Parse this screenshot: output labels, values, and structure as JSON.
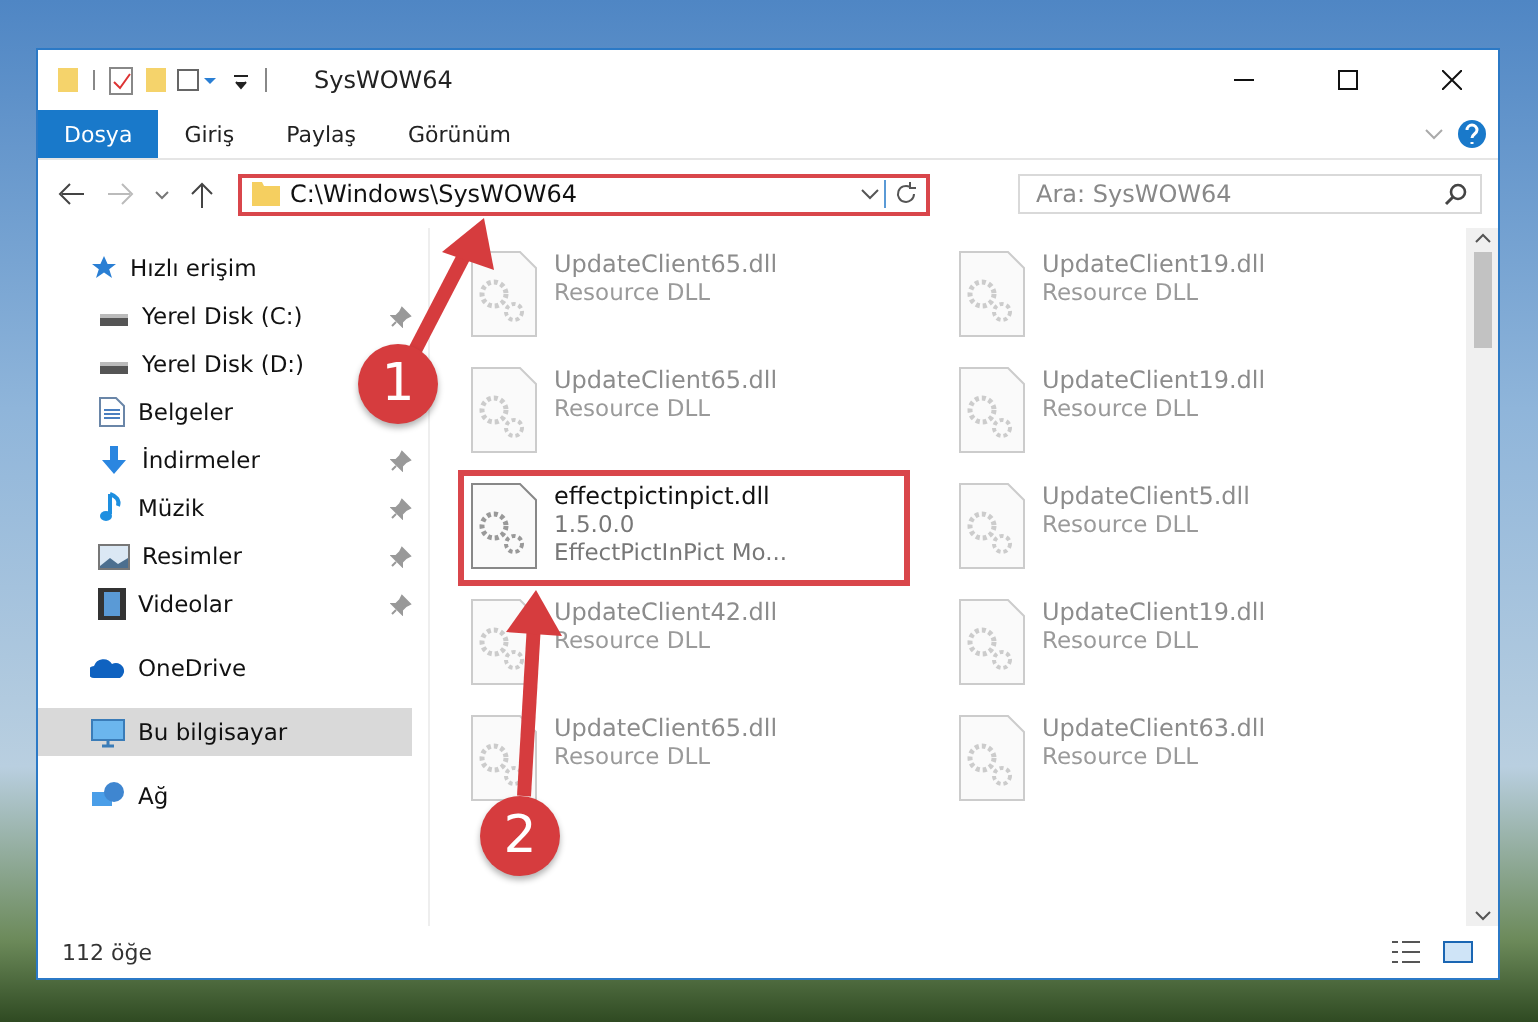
{
  "window": {
    "title": "SysWOW64"
  },
  "ribbon_tabs": [
    {
      "label": "Dosya",
      "selected": true
    },
    {
      "label": "Giriş",
      "selected": false
    },
    {
      "label": "Paylaş",
      "selected": false
    },
    {
      "label": "Görünüm",
      "selected": false
    }
  ],
  "address_bar": {
    "path": "C:\\Windows\\SysWOW64"
  },
  "search": {
    "placeholder": "Ara: SysWOW64"
  },
  "sidebar": {
    "items": [
      {
        "label": "Hızlı erişim",
        "selected": false,
        "children": [
          {
            "label": "Yerel Disk (C:)",
            "pinned": true,
            "selected": false
          },
          {
            "label": "Yerel Disk (D:)",
            "pinned": false,
            "selected": false
          },
          {
            "label": "Belgeler",
            "pinned": false,
            "selected": false
          },
          {
            "label": "İndirmeler",
            "pinned": true,
            "selected": false
          },
          {
            "label": "Müzik",
            "pinned": true,
            "selected": false
          },
          {
            "label": "Resimler",
            "pinned": true,
            "selected": false
          },
          {
            "label": "Videolar",
            "pinned": true,
            "selected": false
          }
        ]
      },
      {
        "label": "OneDrive",
        "selected": false
      },
      {
        "label": "Bu bilgisayar",
        "selected": true
      },
      {
        "label": "Ağ",
        "selected": false
      }
    ]
  },
  "files": [
    {
      "kind": "faded",
      "name": "UpdateClient65.dll",
      "lines": [
        "Resource DLL"
      ]
    },
    {
      "kind": "faded",
      "name": "UpdateClient19.dll",
      "lines": [
        "Resource DLL"
      ]
    },
    {
      "kind": "faded",
      "name": "UpdateClient65.dll",
      "lines": [
        "Resource DLL"
      ]
    },
    {
      "kind": "faded",
      "name": "UpdateClient19.dll",
      "lines": [
        "Resource DLL"
      ]
    },
    {
      "kind": "focus",
      "name": "effectpictinpict.dll",
      "lines": [
        "1.5.0.0",
        "EffectPictInPict Mo..."
      ]
    },
    {
      "kind": "faded",
      "name": "UpdateClient5.dll",
      "lines": [
        "Resource DLL"
      ]
    },
    {
      "kind": "faded",
      "name": "UpdateClient42.dll",
      "lines": [
        "Resource DLL"
      ]
    },
    {
      "kind": "faded",
      "name": "UpdateClient19.dll",
      "lines": [
        "Resource DLL"
      ]
    },
    {
      "kind": "faded",
      "name": "UpdateClient65.dll",
      "lines": [
        "Resource DLL"
      ]
    },
    {
      "kind": "faded",
      "name": "UpdateClient63.dll",
      "lines": [
        "Resource DLL"
      ]
    }
  ],
  "status_bar": {
    "count": "112 öğe"
  },
  "annotations": [
    {
      "number": "1"
    },
    {
      "number": "2"
    }
  ]
}
